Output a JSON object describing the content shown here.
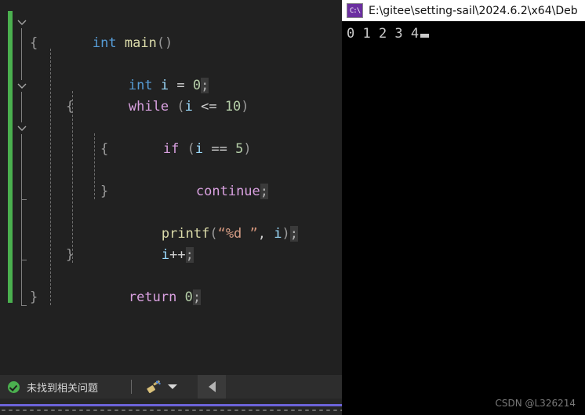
{
  "editor": {
    "language": "c",
    "background_color": "#212121",
    "change_bar_color": "#4bb04f",
    "code_lines": [
      {
        "indent": 0,
        "text": "int main()"
      },
      {
        "indent": 0,
        "text": "{"
      },
      {
        "indent": 1,
        "text": "int i = 0;"
      },
      {
        "indent": 1,
        "text": "while (i <= 10)"
      },
      {
        "indent": 1,
        "text": "{"
      },
      {
        "indent": 2,
        "text": "if (i == 5)"
      },
      {
        "indent": 2,
        "text": "{"
      },
      {
        "indent": 3,
        "text": "continue;"
      },
      {
        "indent": 2,
        "text": "}"
      },
      {
        "indent": 2,
        "text": "printf(\"%d \", i);"
      },
      {
        "indent": 2,
        "text": "i++;"
      },
      {
        "indent": 1,
        "text": "}"
      },
      {
        "indent": 1,
        "text": "return 0;"
      },
      {
        "indent": 0,
        "text": "}"
      }
    ],
    "tokens": {
      "t_main": "main",
      "t_int": "int",
      "t_while": "while",
      "t_if": "if",
      "t_continue": "continue",
      "t_return": "return",
      "t_printf": "printf",
      "t_var_i": "i",
      "t_num_0": "0",
      "t_num_5": "5",
      "t_num_10": "10",
      "t_fmt": "%d ",
      "t_semicolon": ";",
      "t_open_brace": "{",
      "t_close_brace": "}",
      "t_open_paren": "(",
      "t_close_paren": ")",
      "t_empty_parens": "()",
      "t_assign": "=",
      "t_le": "<=",
      "t_eq": "==",
      "t_inc": "++",
      "t_comma": ",",
      "t_quote_open": "“",
      "t_quote_close": "”"
    },
    "colors": {
      "keyword": "#d8a0df",
      "type": "#569cd6",
      "function": "#dcdcaa",
      "variable": "#9cdcfe",
      "number": "#b5cea8",
      "string": "#ce9178",
      "punctuation": "#cfcfcf"
    }
  },
  "status_bar": {
    "message": "未找到相关问题",
    "check_icon": "check-circle-icon",
    "broom_icon": "broom-icon",
    "caret_icon": "chevron-down-icon",
    "back_icon": "chevron-left-icon"
  },
  "console": {
    "app_icon": "console-app-icon",
    "title": "E:\\gitee\\setting-sail\\2024.6.2\\x64\\Deb",
    "output": "0 1 2 3 4",
    "cursor": "block-cursor"
  },
  "watermark": {
    "text": "CSDN @L326214"
  }
}
